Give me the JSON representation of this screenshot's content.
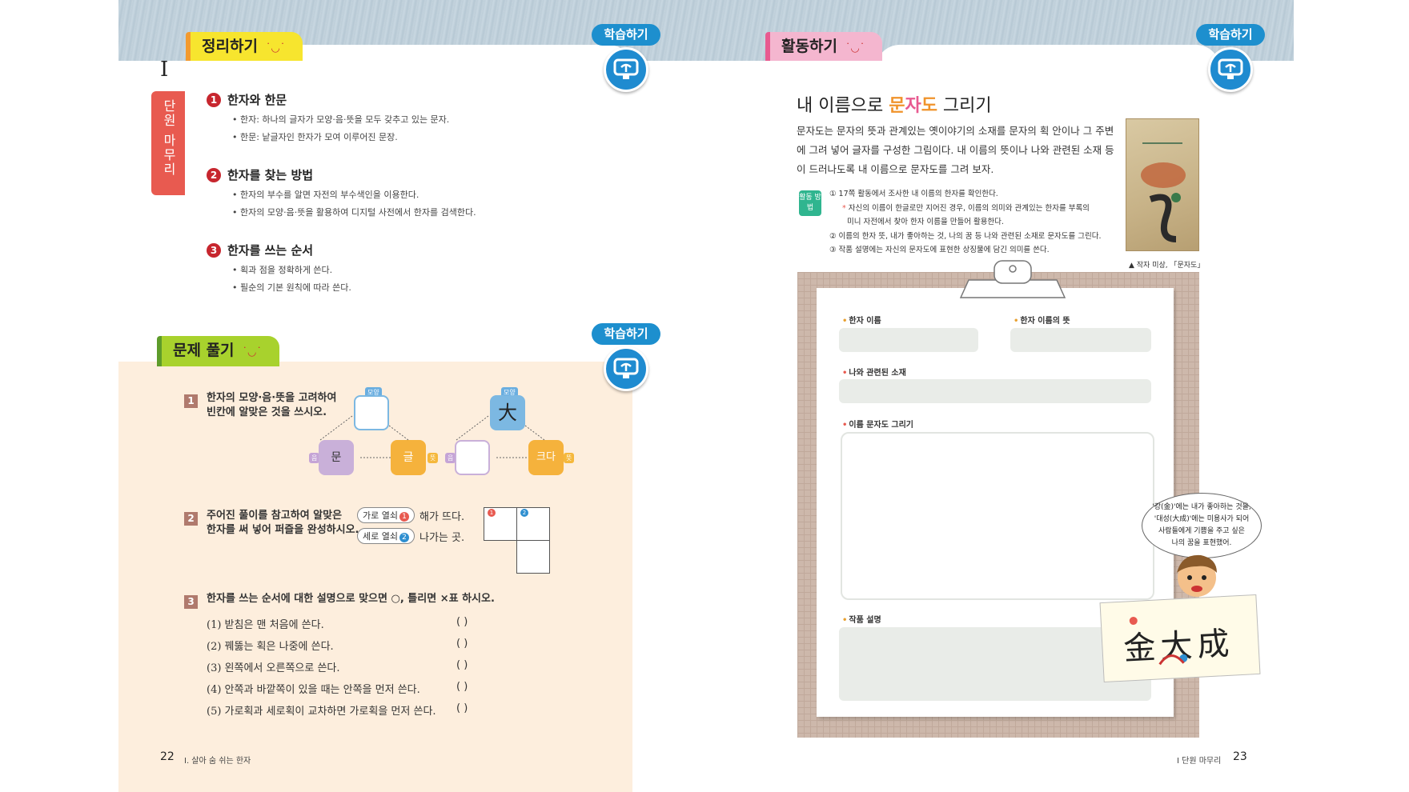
{
  "left_page": {
    "summary_tab": "정리하기",
    "study_label_1": "학습하기",
    "unit_numeral": "I",
    "unit_vertical": "단원 마무리",
    "summary": [
      {
        "num": "1",
        "title": "한자와 한문",
        "lines": [
          "• 한자: 하나의 글자가 모양·음·뜻을 모두 갖추고 있는 문자.",
          "• 한문: 낱글자인 한자가 모여 이루어진 문장."
        ]
      },
      {
        "num": "2",
        "title": "한자를 찾는 방법",
        "lines": [
          "• 한자의 부수를 알면 자전의 부수색인을 이용한다.",
          "• 한자의 모양·음·뜻을 활용하여 디지털 사전에서 한자를 검색한다."
        ]
      },
      {
        "num": "3",
        "title": "한자를 쓰는 순서",
        "lines": [
          "• 획과 점을 정확하게 쓴다.",
          "• 필순의 기본 원칙에 따라 쓴다."
        ]
      }
    ],
    "problems_tab": "문제 풀기",
    "study_label_2": "학습하기",
    "p1": {
      "num": "1",
      "text_1": "한자의 모양·음·뜻을 고려하여",
      "text_2": "빈칸에 알맞은 것을 쓰시오.",
      "tag_shape": "모양",
      "tag_sound": "음",
      "tag_meaning": "뜻",
      "box_mun": "문",
      "box_geul": "글",
      "box_dae": "大",
      "box_keuda": "크다"
    },
    "p2": {
      "num": "2",
      "text_1": "주어진 풀이를 참고하여 알맞은",
      "text_2": "한자를 써 넣어 퍼즐을 완성하시오.",
      "clue_across_label": "가로 열쇠",
      "clue_across_num": "1",
      "clue_across_text": "해가 뜨다.",
      "clue_down_label": "세로 열쇠",
      "clue_down_num": "2",
      "clue_down_text": "나가는 곳.",
      "cell_1": "1",
      "cell_2": "2"
    },
    "p3": {
      "num": "3",
      "text": "한자를 쓰는 순서에 대한 설명으로 맞으면 ○, 틀리면 ×표 하시오.",
      "items": [
        "(1) 받침은 맨 처음에 쓴다.",
        "(2) 꿰뚫는 획은 나중에 쓴다.",
        "(3) 왼쪽에서 오른쪽으로 쓴다.",
        "(4) 안쪽과 바깥쪽이 있을 때는 안쪽을 먼저 쓴다.",
        "(5) 가로획과 세로획이 교차하면 가로획을 먼저 쓴다."
      ],
      "paren": "(        )"
    },
    "page_number": "22",
    "footer_title": "I. 살아 숨 쉬는 한자"
  },
  "right_page": {
    "activity_tab": "활동하기",
    "study_label": "학습하기",
    "title_pre": "내 이름으로 ",
    "title_k1": "문",
    "title_k2": "자",
    "title_k3": "도",
    "title_post": " 그리기",
    "intro": "문자도는 문자의 뜻과 관계있는 옛이야기의 소재를 문자의 획 안이나 그 주변에 그려 넣어 글자를 구성한 그림이다. 내 이름의 뜻이나 나와 관련된 소재 등이 드러나도록 내 이름으로 문자도를 그려 보자.",
    "method_badge": "활동 방법",
    "method_1": "① 17쪽 활동에서 조사한 내 이름의 한자를 확인한다.",
    "method_1_sub_a": "자신의 이름이 한글로만 지어진 경우, 이름의 의미와 관계있는 한자를 부록의",
    "method_1_sub_b": "미니 자전에서 찾아 한자 이름을 만들어 활용한다.",
    "method_2": "② 이름의 한자 뜻, 내가 좋아하는 것, 나의 꿈 등 나와 관련된 소재로 문자도를 그린다.",
    "method_3": "③ 작품 설명에는 자신의 문자도에 표현한 상징물에 담긴 의미를 쓴다.",
    "painting_caption": "▲ 작자 미상, 「문자도」",
    "label_name": "한자 이름",
    "label_meaning": "한자 이름의 뜻",
    "label_related": "나와 관련된 소재",
    "label_draw": "이름 문자도 그리기",
    "label_desc": "작품 설명",
    "bubble_text_1": "'강(金)'에는 내가 좋아하는 것을,",
    "bubble_text_2": "'대성(大成)'에는 미용사가 되어",
    "bubble_text_3": "사람들에게 기쁨을 주고 싶은",
    "bubble_text_4": "나의 꿈을 표현했어.",
    "card_text": "金大成",
    "footer_title": "I 단원 마무리",
    "page_number": "23"
  },
  "colors": {
    "accent_blue": "#1d8fce",
    "red": "#c7262e",
    "yellow_tab": "#f7e52e",
    "pink_tab": "#f4b6cf",
    "green_tab": "#a8d22d",
    "problems_bg": "#fdeedd"
  },
  "icons": {
    "study": "monitor-book-icon"
  }
}
